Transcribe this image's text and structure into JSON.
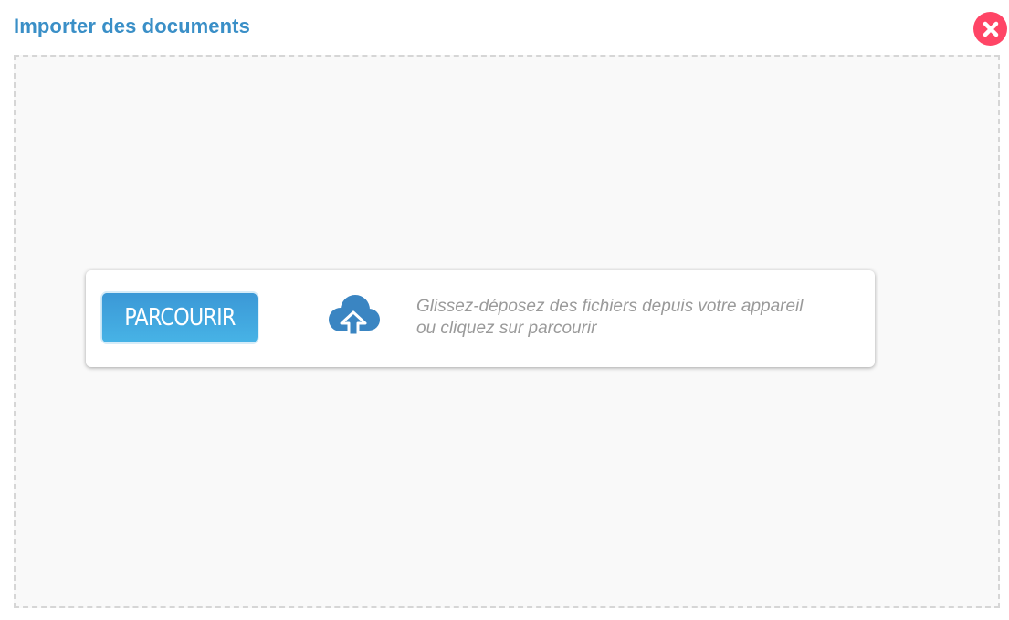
{
  "dialog": {
    "title": "Importer des documents",
    "close_icon": "close-circle-icon",
    "accent_color": "#3a8fc7",
    "close_color": "#ff4566"
  },
  "upload": {
    "browse_label": "PARCOURIR",
    "cloud_icon": "cloud-upload-icon",
    "instruction_line1": "Glissez-déposez des fichiers depuis votre appareil",
    "instruction_line2": "ou cliquez sur parcourir"
  }
}
